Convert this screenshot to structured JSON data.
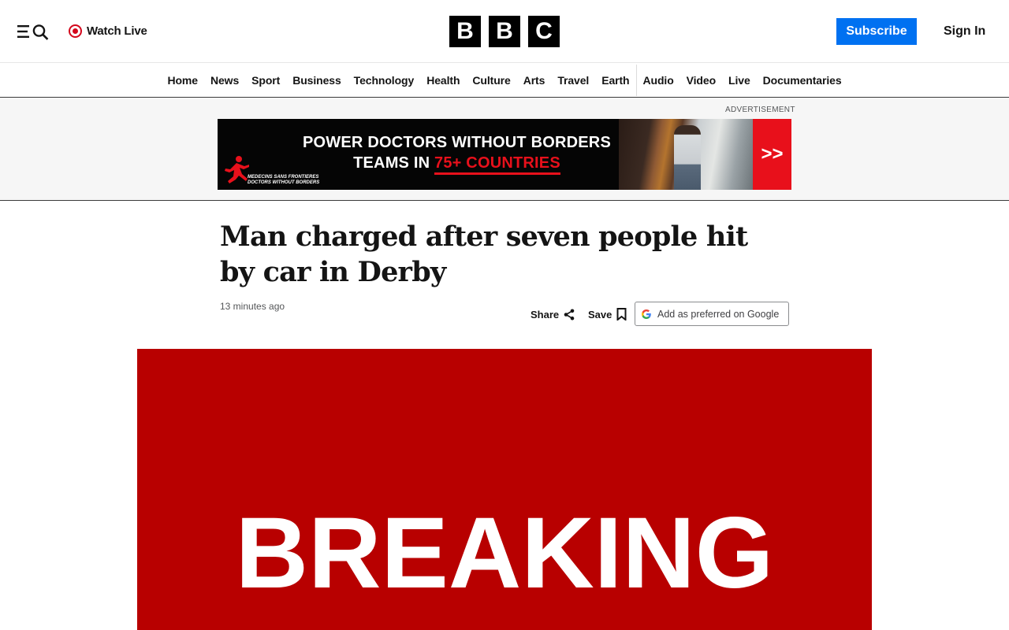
{
  "header": {
    "watch_live_label": "Watch Live",
    "logo_letters": [
      "B",
      "B",
      "C"
    ],
    "subscribe_label": "Subscribe",
    "sign_in_label": "Sign In"
  },
  "nav": {
    "items": [
      "Home",
      "News",
      "Sport",
      "Business",
      "Technology",
      "Health",
      "Culture",
      "Arts",
      "Travel",
      "Earth",
      "Audio",
      "Video",
      "Live",
      "Documentaries"
    ]
  },
  "advert": {
    "label": "ADVERTISEMENT",
    "line1": "POWER DOCTORS WITHOUT BORDERS",
    "line2_prefix": "TEAMS IN ",
    "line2_highlight": "75+ COUNTRIES",
    "logo_text_1": "MEDECINS SANS FRONTIERES",
    "logo_text_2": "DOCTORS WITHOUT BORDERS",
    "arrow": ">>"
  },
  "article": {
    "headline": "Man charged after seven people hit by car in Derby",
    "timestamp": "13 minutes ago",
    "share_label": "Share",
    "save_label": "Save",
    "google_pref_label": "Add as preferred on Google",
    "hero_text": "BREAKING"
  },
  "colors": {
    "subscribe_bg": "#0071f1",
    "live_red": "#d4071c",
    "hero_red": "#b80000",
    "advert_red": "#e8101b"
  }
}
